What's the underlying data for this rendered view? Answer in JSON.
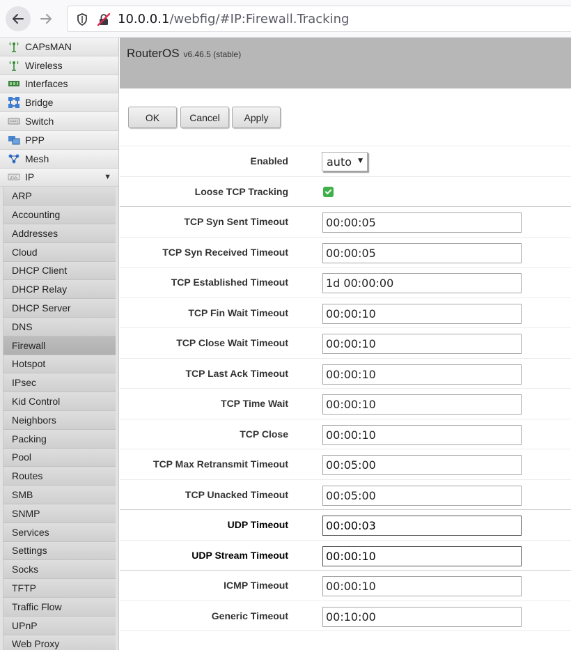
{
  "browser": {
    "url_host": "10.0.0.1",
    "url_path": "/webfig/#IP:Firewall.Tracking",
    "back_icon": "arrow-left-icon",
    "forward_icon": "arrow-right-icon",
    "shield_icon": "shield-icon",
    "insecure_icon": "insecure-connection-icon"
  },
  "sidebar": {
    "top_items": [
      {
        "label": "CAPsMAN",
        "icon": "antenna-icon"
      },
      {
        "label": "Wireless",
        "icon": "antenna-icon"
      },
      {
        "label": "Interfaces",
        "icon": "interface-card-icon"
      },
      {
        "label": "Bridge",
        "icon": "bridge-icon"
      },
      {
        "label": "Switch",
        "icon": "switch-icon"
      },
      {
        "label": "PPP",
        "icon": "ppp-icon"
      },
      {
        "label": "Mesh",
        "icon": "mesh-icon"
      },
      {
        "label": "IP",
        "icon": "ip-icon",
        "expanded": true
      }
    ],
    "ip_submenu": [
      {
        "label": "ARP"
      },
      {
        "label": "Accounting"
      },
      {
        "label": "Addresses"
      },
      {
        "label": "Cloud"
      },
      {
        "label": "DHCP Client"
      },
      {
        "label": "DHCP Relay"
      },
      {
        "label": "DHCP Server"
      },
      {
        "label": "DNS"
      },
      {
        "label": "Firewall",
        "active": true
      },
      {
        "label": "Hotspot"
      },
      {
        "label": "IPsec"
      },
      {
        "label": "Kid Control"
      },
      {
        "label": "Neighbors"
      },
      {
        "label": "Packing"
      },
      {
        "label": "Pool"
      },
      {
        "label": "Routes"
      },
      {
        "label": "SMB"
      },
      {
        "label": "SNMP"
      },
      {
        "label": "Services"
      },
      {
        "label": "Settings"
      },
      {
        "label": "Socks"
      },
      {
        "label": "TFTP"
      },
      {
        "label": "Traffic Flow"
      },
      {
        "label": "UPnP"
      },
      {
        "label": "Web Proxy"
      }
    ]
  },
  "header": {
    "product": "RouterOS",
    "version": "v6.46.5 (stable)"
  },
  "buttons": {
    "ok": "OK",
    "cancel": "Cancel",
    "apply": "Apply"
  },
  "form": {
    "enabled": {
      "label": "Enabled",
      "value": "auto"
    },
    "loose_tcp_tracking": {
      "label": "Loose TCP Tracking",
      "checked": true
    },
    "fields": [
      {
        "label": "TCP Syn Sent Timeout",
        "value": "00:00:05"
      },
      {
        "label": "TCP Syn Received Timeout",
        "value": "00:00:05"
      },
      {
        "label": "TCP Established Timeout",
        "value": "1d 00:00:00"
      },
      {
        "label": "TCP Fin Wait Timeout",
        "value": "00:00:10"
      },
      {
        "label": "TCP Close Wait Timeout",
        "value": "00:00:10"
      },
      {
        "label": "TCP Last Ack Timeout",
        "value": "00:00:10"
      },
      {
        "label": "TCP Time Wait",
        "value": "00:00:10"
      },
      {
        "label": "TCP Close",
        "value": "00:00:10"
      },
      {
        "label": "TCP Max Retransmit Timeout",
        "value": "00:05:00"
      },
      {
        "label": "TCP Unacked Timeout",
        "value": "00:05:00"
      },
      {
        "label": "UDP Timeout",
        "value": "00:00:03"
      },
      {
        "label": "UDP Stream Timeout",
        "value": "00:00:10"
      },
      {
        "label": "ICMP Timeout",
        "value": "00:00:10"
      },
      {
        "label": "Generic Timeout",
        "value": "00:10:00"
      }
    ]
  },
  "colors": {
    "header_bg": "#b7b7b7",
    "checkbox_green": "#3fb04a",
    "sidebar_active": "#b0b0b0"
  }
}
